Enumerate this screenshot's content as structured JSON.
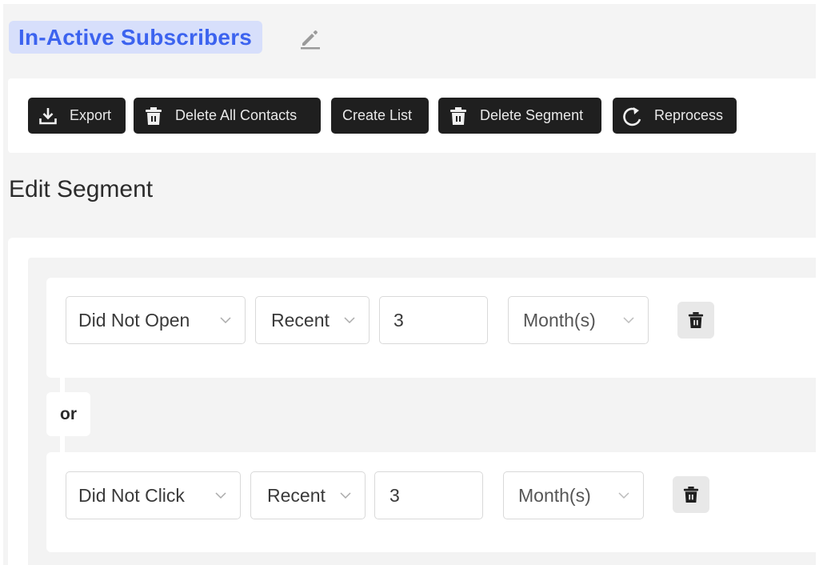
{
  "header": {
    "segment_name": "In-Active Subscribers",
    "edit_icon": "pencil-icon",
    "accent_color": "#3c63ef",
    "accent_bg": "#d7dffb"
  },
  "toolbar": {
    "buttons": [
      {
        "label": "Export",
        "icon": "download-icon"
      },
      {
        "label": "Delete All Contacts",
        "icon": "trash-icon"
      },
      {
        "label": "Create List",
        "icon": ""
      },
      {
        "label": "Delete Segment",
        "icon": "trash-icon"
      },
      {
        "label": "Reprocess",
        "icon": "refresh-icon"
      }
    ]
  },
  "editor": {
    "title": "Edit Segment",
    "connector_label": "or",
    "rules": [
      {
        "condition": "Did Not Open",
        "timeframe": "Recent",
        "amount": "3",
        "unit": "Month(s)",
        "delete_icon": "trash-icon"
      },
      {
        "condition": "Did Not Click",
        "timeframe": "Recent",
        "amount": "3",
        "unit": "Month(s)",
        "delete_icon": "trash-icon"
      }
    ]
  }
}
